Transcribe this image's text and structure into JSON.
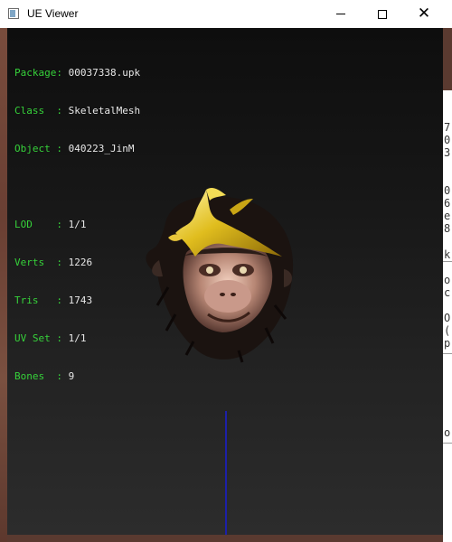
{
  "window": {
    "title": "UE Viewer",
    "minimize_glyph": "",
    "maximize_glyph": "",
    "close_glyph": "✕"
  },
  "info": {
    "package": {
      "key": "Package: ",
      "value": "00037338.upk"
    },
    "class": {
      "key": "Class  : ",
      "value": "SkeletalMesh"
    },
    "object": {
      "key": "Object : ",
      "value": "040223_JinM"
    },
    "lod": {
      "key": "LOD    : ",
      "value": "1/1"
    },
    "verts": {
      "key": "Verts  : ",
      "value": "1226"
    },
    "tris": {
      "key": "Tris   : ",
      "value": "1743"
    },
    "uvset": {
      "key": "UV Set : ",
      "value": "1/1"
    },
    "bones": {
      "key": "Bones  : ",
      "value": "9"
    }
  },
  "background": {
    "right_chars": [
      "7",
      "0",
      "3",
      "0",
      "6",
      "e",
      "8",
      "k",
      "o",
      "c",
      "O",
      "(",
      "p",
      "o"
    ]
  },
  "colors": {
    "label_green": "#36d23a",
    "value_white": "#e8e8e8",
    "axis_blue": "#1d20a8",
    "crown_gold": "#d8b21a"
  },
  "model": {
    "name": "monkey-head-mesh-icon"
  }
}
